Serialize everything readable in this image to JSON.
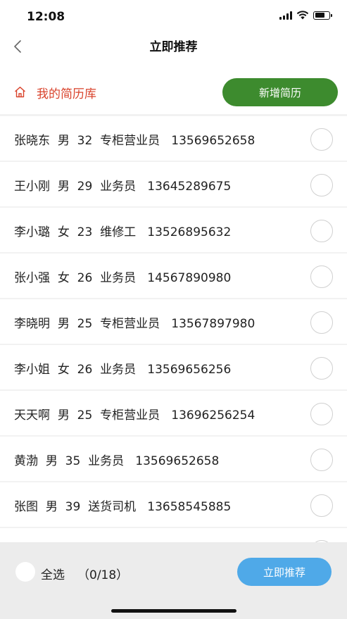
{
  "status": {
    "time": "12:08"
  },
  "nav": {
    "title": "立即推荐"
  },
  "library": {
    "label": "我的简历库",
    "add_button": "新增简历"
  },
  "resumes": [
    {
      "name": "张晓东",
      "gender": "男",
      "age": "32",
      "position": "专柜营业员",
      "phone": "13569652658"
    },
    {
      "name": "王小刚",
      "gender": "男",
      "age": "29",
      "position": "业务员",
      "phone": "13645289675"
    },
    {
      "name": "李小璐",
      "gender": "女",
      "age": "23",
      "position": "维修工",
      "phone": "13526895632"
    },
    {
      "name": "张小强",
      "gender": "女",
      "age": "26",
      "position": "业务员",
      "phone": "14567890980"
    },
    {
      "name": "李晓明",
      "gender": "男",
      "age": "25",
      "position": "专柜营业员",
      "phone": "13567897980"
    },
    {
      "name": "李小姐",
      "gender": "女",
      "age": "26",
      "position": "业务员",
      "phone": "13569656256"
    },
    {
      "name": "天天啊",
      "gender": "男",
      "age": "25",
      "position": "专柜营业员",
      "phone": "13696256254"
    },
    {
      "name": "黄渤",
      "gender": "男",
      "age": "35",
      "position": "业务员",
      "phone": "13569652658"
    },
    {
      "name": "张图",
      "gender": "男",
      "age": "39",
      "position": "送货司机",
      "phone": "13658545885"
    }
  ],
  "footer": {
    "select_all": "全选",
    "count": "（0/18）",
    "recommend_button": "立即推荐"
  },
  "colors": {
    "accent_green": "#3d8b2e",
    "accent_red": "#d9432c",
    "accent_blue": "#4fa9e8"
  }
}
